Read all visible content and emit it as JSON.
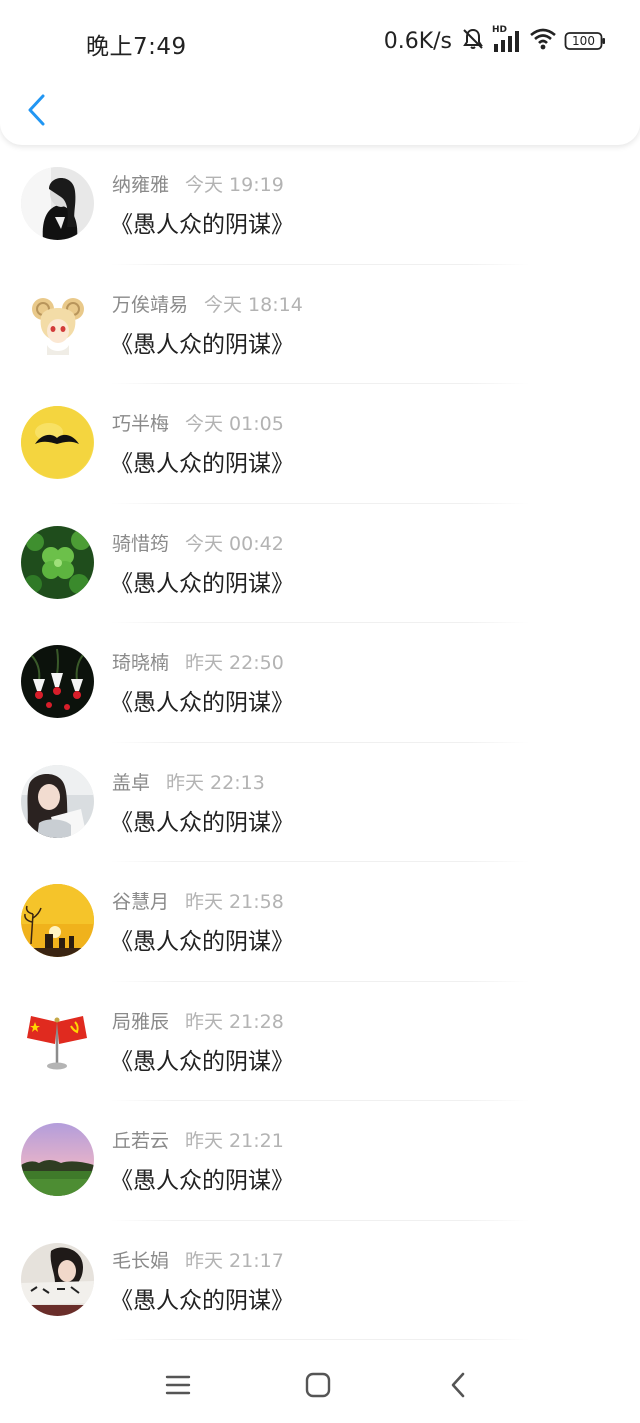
{
  "status_bar": {
    "time": "晚上7:49",
    "net_speed": "0.6K/s",
    "hd_label": "HD",
    "battery": "100"
  },
  "header": {
    "back_icon": "chevron-left-icon",
    "accent_color": "#2196f3"
  },
  "messages": [
    {
      "name": "纳雍雅",
      "time": "今天 19:19",
      "text": "《愚人众的阴谋》",
      "avatar": "portrait-black-white"
    },
    {
      "name": "万俟靖易",
      "time": "今天 18:14",
      "text": "《愚人众的阴谋》",
      "avatar": "anime-ram-horns"
    },
    {
      "name": "巧半梅",
      "time": "今天 01:05",
      "text": "《愚人众的阴谋》",
      "avatar": "yellow-mustache"
    },
    {
      "name": "骑惜筠",
      "time": "今天 00:42",
      "text": "《愚人众的阴谋》",
      "avatar": "green-clover"
    },
    {
      "name": "琦晓楠",
      "time": "昨天 22:50",
      "text": "《愚人众的阴谋》",
      "avatar": "fuchsia-flowers"
    },
    {
      "name": "盖卓",
      "time": "昨天 22:13",
      "text": "《愚人众的阴谋》",
      "avatar": "girl-portrait"
    },
    {
      "name": "谷慧月",
      "time": "昨天 21:58",
      "text": "《愚人众的阴谋》",
      "avatar": "sunset-yellow"
    },
    {
      "name": "局雅辰",
      "time": "昨天 21:28",
      "text": "《愚人众的阴谋》",
      "avatar": "red-flags"
    },
    {
      "name": "丘若云",
      "time": "昨天 21:21",
      "text": "《愚人众的阴谋》",
      "avatar": "purple-sky-field"
    },
    {
      "name": "毛长娟",
      "time": "昨天 21:17",
      "text": "《愚人众的阴谋》",
      "avatar": "girl-calligraphy"
    }
  ],
  "nav_bar": {
    "menu_icon": "menu-icon",
    "home_icon": "home-square-icon",
    "back_icon": "back-chevron-icon"
  }
}
